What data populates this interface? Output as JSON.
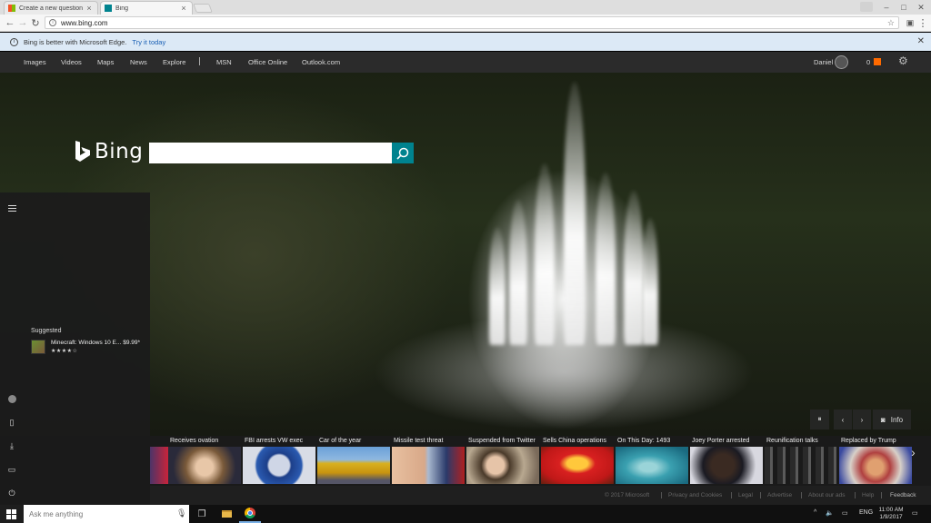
{
  "browser": {
    "tabs": [
      {
        "title": "Create a new question or s",
        "active": false
      },
      {
        "title": "Bing",
        "active": true
      }
    ],
    "url": "www.bing.com",
    "window_controls": {
      "minimize": "–",
      "maximize": "□",
      "close": "✕"
    }
  },
  "banner": {
    "message": "Bing is better with Microsoft Edge.",
    "link": "Try it today"
  },
  "nav": {
    "items": [
      "Images",
      "Videos",
      "Maps",
      "News",
      "Explore"
    ],
    "separator": "|",
    "secondary": [
      "MSN",
      "Office Online",
      "Outlook.com"
    ],
    "user_name": "Daniel",
    "rewards_count": "0"
  },
  "search": {
    "brand": "Bing",
    "value": ""
  },
  "start_menu": {
    "suggested_label": "Suggested",
    "app": {
      "name": "Minecraft: Windows 10 E...",
      "price": "$9.99*",
      "stars": "★★★★☆"
    }
  },
  "hero_controls": {
    "info": "Info"
  },
  "news": [
    {
      "title": "Receives ovation"
    },
    {
      "title": "FBI arrests VW exec"
    },
    {
      "title": "Car of the year"
    },
    {
      "title": "Missile test threat"
    },
    {
      "title": "Suspended from Twitter"
    },
    {
      "title": "Sells China operations"
    },
    {
      "title": "On This Day: 1493"
    },
    {
      "title": "Joey Porter arrested"
    },
    {
      "title": "Reunification talks"
    },
    {
      "title": "Replaced by Trump"
    }
  ],
  "footer": {
    "copyright": "© 2017 Microsoft",
    "links": [
      "Privacy and Cookies",
      "Legal",
      "Advertise",
      "About our ads",
      "Help"
    ],
    "feedback": "Feedback"
  },
  "taskbar": {
    "search_placeholder": "Ask me anything",
    "language": "ENG",
    "time": "11:00 AM",
    "date": "1/9/2017"
  },
  "colors": {
    "search_button": "#00838f",
    "nav_bg": "#2b2b2b",
    "banner_bg": "#dce9f6",
    "rewards": "#ff6a00"
  }
}
